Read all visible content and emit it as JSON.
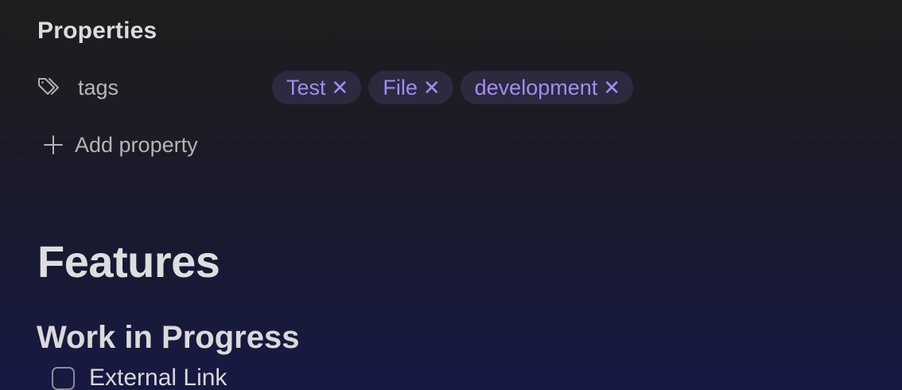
{
  "properties": {
    "heading": "Properties",
    "rows": [
      {
        "icon": "tag-icon",
        "key": "tags",
        "values": [
          "Test",
          "File",
          "development"
        ]
      }
    ],
    "remove_glyph": "✕",
    "add_label": "Add property"
  },
  "content": {
    "h1": "Features",
    "h2": "Work in Progress",
    "tasks": [
      {
        "label": "External Link",
        "checked": false
      }
    ]
  },
  "colors": {
    "accent": "#a48af4",
    "pill_bg": "#2c2a3f",
    "text": "#dadada"
  }
}
